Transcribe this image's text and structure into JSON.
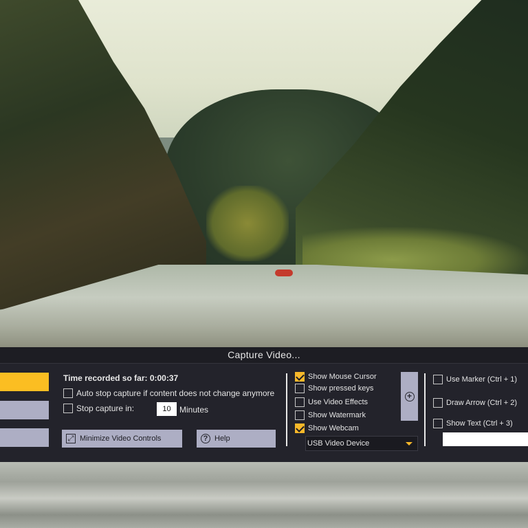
{
  "panel": {
    "title": "Capture Video...",
    "time_recorded_label": "Time recorded so far: 0:00:37",
    "auto_stop_label": "Auto stop capture if content does not change anymore",
    "auto_stop_checked": false,
    "stop_capture_label": "Stop capture in:",
    "stop_capture_checked": false,
    "stop_minutes_value": "10",
    "minutes_label": "Minutes",
    "minimize_label": "Minimize Video Controls",
    "help_label": "Help",
    "options": [
      {
        "label": "Show Mouse Cursor",
        "checked": true
      },
      {
        "label": "Show pressed keys",
        "checked": false
      },
      {
        "label": "Use Video Effects",
        "checked": false
      },
      {
        "label": "Show Watermark",
        "checked": false
      },
      {
        "label": "Show Webcam",
        "checked": true
      }
    ],
    "webcam_device": "USB Video Device",
    "annotations": [
      {
        "label": "Use Marker (Ctrl + 1)",
        "checked": false
      },
      {
        "label": "Draw Arrow (Ctrl + 2)",
        "checked": false
      },
      {
        "label": "Show Text (Ctrl + 3)",
        "checked": false
      }
    ],
    "text_value": ""
  },
  "colors": {
    "accent": "#fbbe22",
    "panel_bg": "#23232b",
    "button_gray": "#adaec4"
  },
  "icons": {
    "minimize": "minimize-arrows-icon",
    "help": "question-circle-icon",
    "add": "plus-circle-icon",
    "dropdown": "chevron-down-icon"
  }
}
